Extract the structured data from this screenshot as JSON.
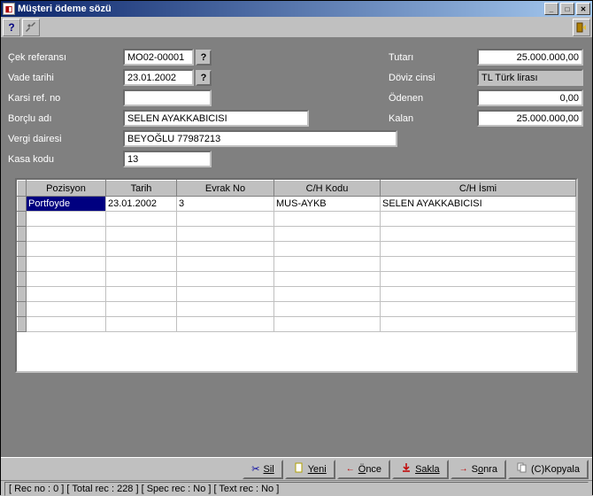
{
  "window": {
    "title": "Müşteri ödeme sözü"
  },
  "form": {
    "left": {
      "cek_ref_lbl": "Çek referansı",
      "cek_ref": "MO02-00001",
      "vade_lbl": "Vade tarihi",
      "vade": "23.01.2002",
      "karsi_lbl": "Karsi ref. no",
      "karsi": "",
      "borclu_lbl": "Borçlu adı",
      "borclu": "SELEN AYAKKABICISI",
      "vergi_lbl": "Vergi dairesi",
      "vergi": "BEYOĞLU 77987213",
      "kasa_lbl": "Kasa kodu",
      "kasa": "13"
    },
    "right": {
      "tutari_lbl": "Tutarı",
      "tutari": "25.000.000,00",
      "doviz_lbl": "Döviz cinsi",
      "doviz": "TL  Türk lirası",
      "odenen_lbl": "Ödenen",
      "odenen": "0,00",
      "kalan_lbl": "Kalan",
      "kalan": "25.000.000,00"
    }
  },
  "table": {
    "headers": {
      "pozisyon": "Pozisyon",
      "tarih": "Tarih",
      "evrak": "Evrak No",
      "chkodu": "C/H Kodu",
      "chismi": "C/H İsmi"
    },
    "row": {
      "pozisyon": "Portfoyde",
      "tarih": "23.01.2002",
      "evrak": "3",
      "chkodu": "MUS-AYKB",
      "chismi": "SELEN AYAKKABICISI"
    }
  },
  "buttons": {
    "sil": "Sil",
    "yeni": "Yeni",
    "once": "Önce",
    "sakla": "Sakla",
    "sonra": "Sonra",
    "kopyala": "(C)Kopyala"
  },
  "statusbar": {
    "text": "[ Rec no :     0  ] [ Total rec :   228  ] [ Spec rec : No ] [ Text rec : No  ]"
  }
}
